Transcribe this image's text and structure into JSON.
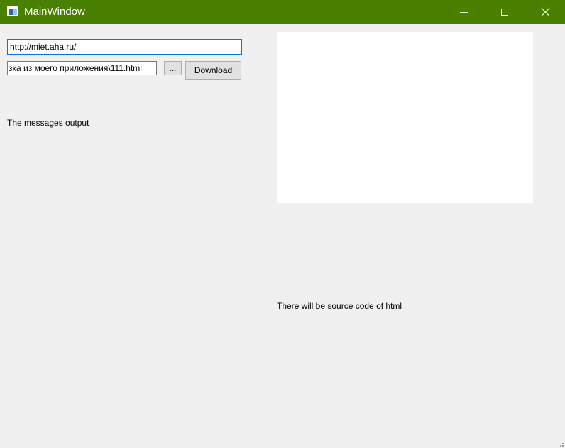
{
  "window": {
    "title": "MainWindow",
    "titlebar_color": "#4a8000",
    "controls": {
      "minimize_icon": "minimize-icon",
      "maximize_icon": "maximize-icon",
      "close_icon": "close-icon"
    }
  },
  "form": {
    "url_value": "http://miet.aha.ru/",
    "path_value": "зка из моего приложения\\111.html",
    "browse_label": "...",
    "download_label": "Download"
  },
  "labels": {
    "messages_output": "The messages output",
    "source_code": "There will be source code of html"
  }
}
